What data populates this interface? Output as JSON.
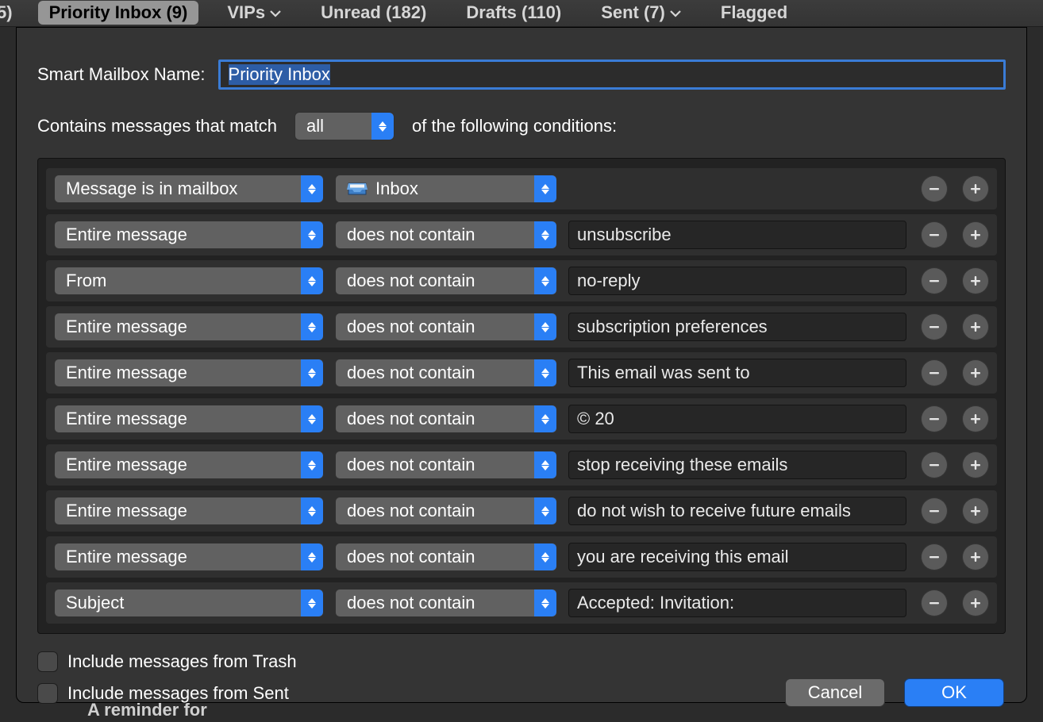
{
  "tab_bar": {
    "items": [
      {
        "label": "5)",
        "has_caret": false,
        "selected": false,
        "is_fragment": true
      },
      {
        "label": "Priority Inbox (9)",
        "has_caret": false,
        "selected": true
      },
      {
        "label": "VIPs",
        "has_caret": true,
        "selected": false
      },
      {
        "label": "Unread (182)",
        "has_caret": false,
        "selected": false
      },
      {
        "label": "Drafts (110)",
        "has_caret": false,
        "selected": false
      },
      {
        "label": "Sent (7)",
        "has_caret": true,
        "selected": false
      },
      {
        "label": "Flagged",
        "has_caret": false,
        "selected": false
      }
    ]
  },
  "dialog": {
    "name_label": "Smart Mailbox Name:",
    "name_value": "Priority Inbox",
    "match_label_prefix": "Contains messages that match",
    "match_select_value": "all",
    "match_label_suffix": "of the following conditions:",
    "rules": [
      {
        "field": "Message is in mailbox",
        "op_type": "mailbox",
        "mailbox": "Inbox"
      },
      {
        "field": "Entire message",
        "op": "does not contain",
        "value": "unsubscribe"
      },
      {
        "field": "From",
        "op": "does not contain",
        "value": "no-reply"
      },
      {
        "field": "Entire message",
        "op": "does not contain",
        "value": "subscription preferences"
      },
      {
        "field": "Entire message",
        "op": "does not contain",
        "value": "This email was sent to"
      },
      {
        "field": "Entire message",
        "op": "does not contain",
        "value": "© 20"
      },
      {
        "field": "Entire message",
        "op": "does not contain",
        "value": "stop receiving these emails"
      },
      {
        "field": "Entire message",
        "op": "does not contain",
        "value": "do not wish to receive future emails"
      },
      {
        "field": "Entire message",
        "op": "does not contain",
        "value": "you are receiving this email"
      },
      {
        "field": "Subject",
        "op": "does not contain",
        "value": "Accepted: Invitation:"
      }
    ],
    "include_trash_label": "Include messages from Trash",
    "include_trash_checked": false,
    "include_sent_label": "Include messages from Sent",
    "include_sent_checked": false,
    "cancel_label": "Cancel",
    "ok_label": "OK"
  },
  "background": {
    "under_text": "A reminder for"
  }
}
